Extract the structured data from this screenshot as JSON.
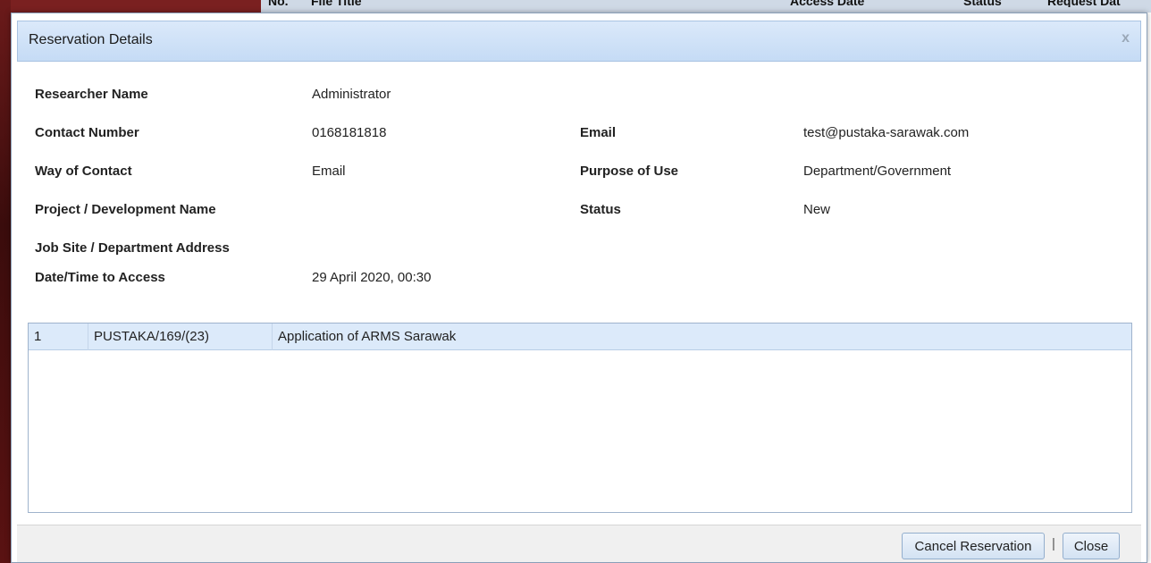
{
  "background": {
    "columns": [
      "No.",
      "File Title",
      "Access Date",
      "Status",
      "Request Dat"
    ]
  },
  "dialog": {
    "title": "Reservation Details",
    "close_icon": "x"
  },
  "details": {
    "researcher_name_label": "Researcher Name",
    "researcher_name_value": "Administrator",
    "contact_number_label": "Contact Number",
    "contact_number_value": "0168181818",
    "email_label": "Email",
    "email_value": "test@pustaka-sarawak.com",
    "way_of_contact_label": "Way of Contact",
    "way_of_contact_value": "Email",
    "purpose_label": "Purpose of Use",
    "purpose_value": "Department/Government",
    "project_label": "Project / Development Name",
    "project_value": "",
    "status_label": "Status",
    "status_value": "New",
    "job_site_label": "Job Site / Department Address",
    "job_site_value": "",
    "datetime_label": "Date/Time to Access",
    "datetime_value": "29 April 2020, 00:30"
  },
  "files": [
    {
      "no": "1",
      "ref": "PUSTAKA/169/(23)",
      "title": "Application of ARMS Sarawak"
    }
  ],
  "footer": {
    "cancel_label": "Cancel Reservation",
    "separator": "|",
    "close_label": "Close"
  }
}
